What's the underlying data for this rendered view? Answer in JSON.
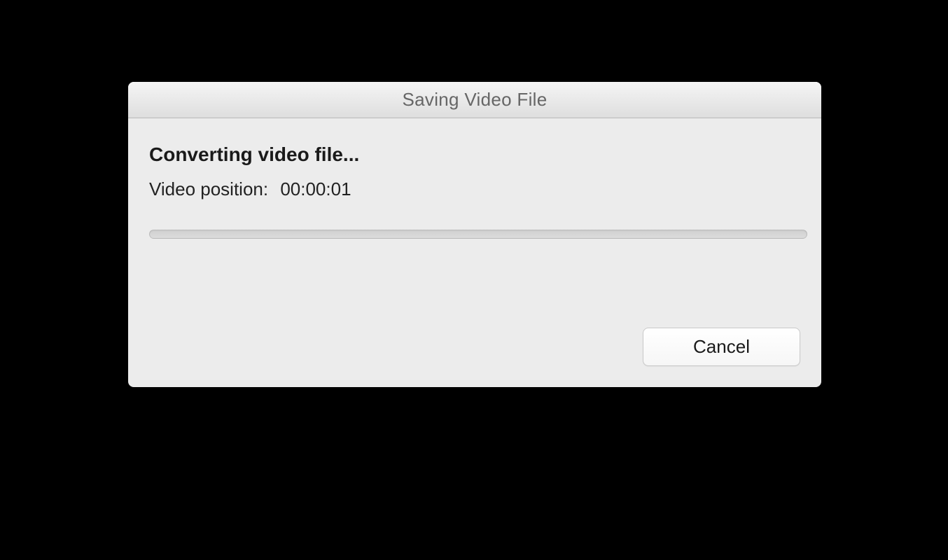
{
  "dialog": {
    "title": "Saving Video File",
    "status": "Converting video file...",
    "position_label": "Video position:",
    "position_value": "00:00:01",
    "cancel_label": "Cancel",
    "progress_percent": 0
  }
}
